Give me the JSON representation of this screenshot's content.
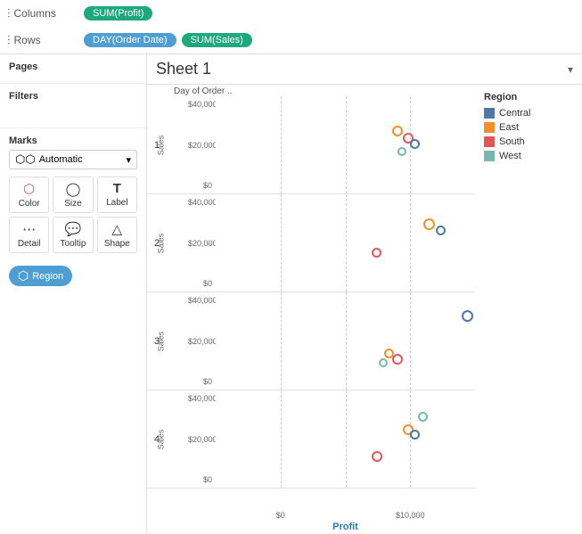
{
  "toolbar": {
    "columns_label": "Columns",
    "rows_label": "Rows",
    "columns_pill": "SUM(Profit)",
    "rows_pill1": "DAY(Order Date)",
    "rows_pill2": "SUM(Sales)",
    "columns_icon": "≡",
    "rows_icon": "≡"
  },
  "sheet": {
    "title": "Sheet 1",
    "x_label": "Day of Order ..",
    "x_axis_label": "Profit",
    "x_ticks": [
      "$0",
      "$10,000"
    ],
    "rows": [
      {
        "label": "1",
        "y_ticks": [
          "$40,000",
          "$20,000",
          "$0"
        ],
        "dots": [
          {
            "x": 68,
            "y": 30,
            "color": "#f28e2b",
            "size": 12
          },
          {
            "x": 72,
            "y": 38,
            "color": "#e15759",
            "size": 12
          },
          {
            "x": 75,
            "y": 44,
            "color": "#4e79a7",
            "size": 11
          },
          {
            "x": 70,
            "y": 52,
            "color": "#76b7b2",
            "size": 10
          }
        ]
      },
      {
        "label": "2",
        "y_ticks": [
          "$40,000",
          "$20,000",
          "$0"
        ],
        "dots": [
          {
            "x": 80,
            "y": 25,
            "color": "#f28e2b",
            "size": 13
          },
          {
            "x": 85,
            "y": 32,
            "color": "#4e79a7",
            "size": 11
          },
          {
            "x": 60,
            "y": 55,
            "color": "#e15759",
            "size": 11
          }
        ]
      },
      {
        "label": "3",
        "y_ticks": [
          "$40,000",
          "$20,000",
          "$0"
        ],
        "dots": [
          {
            "x": 95,
            "y": 18,
            "color": "#4e79a7",
            "size": 13
          },
          {
            "x": 65,
            "y": 58,
            "color": "#f28e2b",
            "size": 11
          },
          {
            "x": 68,
            "y": 63,
            "color": "#e15759",
            "size": 12
          },
          {
            "x": 63,
            "y": 68,
            "color": "#76b7b2",
            "size": 10
          }
        ]
      },
      {
        "label": "4",
        "y_ticks": [
          "$40,000",
          "$20,000",
          "$0"
        ],
        "dots": [
          {
            "x": 78,
            "y": 22,
            "color": "#76b7b2",
            "size": 11
          },
          {
            "x": 72,
            "y": 35,
            "color": "#f28e2b",
            "size": 12
          },
          {
            "x": 75,
            "y": 40,
            "color": "#4e79a7",
            "size": 11
          },
          {
            "x": 60,
            "y": 62,
            "color": "#e15759",
            "size": 12
          }
        ]
      }
    ]
  },
  "left_panel": {
    "pages_label": "Pages",
    "filters_label": "Filters",
    "marks_label": "Marks",
    "marks_type": "Automatic",
    "marks_items": [
      {
        "label": "Color",
        "icon": "⬡"
      },
      {
        "label": "Size",
        "icon": "◯"
      },
      {
        "label": "Label",
        "icon": "T"
      },
      {
        "label": "Detail",
        "icon": "⋯"
      },
      {
        "label": "Tooltip",
        "icon": "💬"
      },
      {
        "label": "Shape",
        "icon": "△"
      }
    ],
    "region_pill": "Region"
  },
  "legend": {
    "title": "Region",
    "items": [
      {
        "label": "Central",
        "color": "#4e79a7"
      },
      {
        "label": "East",
        "color": "#f28e2b"
      },
      {
        "label": "South",
        "color": "#e15759"
      },
      {
        "label": "West",
        "color": "#76b7b2"
      }
    ]
  }
}
